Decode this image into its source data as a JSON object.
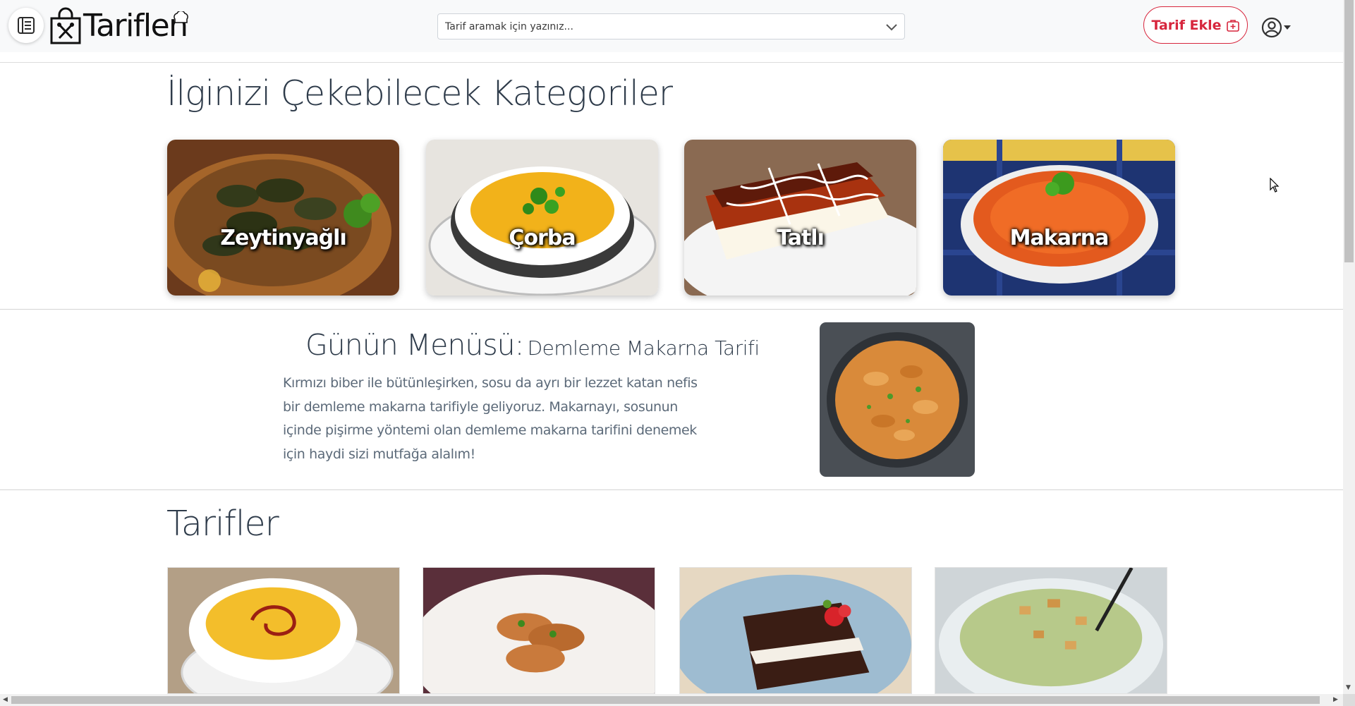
{
  "header": {
    "logo_text": "Tariflen",
    "search_placeholder": "Tarif aramak için yazınız...",
    "add_recipe_label": "Tarif Ekle"
  },
  "categories": {
    "title": "İlginizi Çekebilecek Kategoriler",
    "items": [
      {
        "label": "Zeytinyağlı"
      },
      {
        "label": "Çorba"
      },
      {
        "label": "Tatlı"
      },
      {
        "label": "Makarna"
      }
    ]
  },
  "day_menu": {
    "lead": "Günün Menüsü:",
    "recipe_name": "Demleme Makarna Tarifi",
    "description": "Kırmızı biber ile bütünleşirken, sosu da ayrı bir lezzet katan nefis bir demleme makarna tarifiyle geliyoruz. Makarnayı, sosunun içinde pişirme yöntemi olan demleme makarna tarifini denemek için haydi sizi mutfağa alalım!"
  },
  "recipes": {
    "title": "Tarifler"
  },
  "colors": {
    "accent": "#d7263d",
    "heading": "#2e3b4a",
    "body_text": "#5c6a79",
    "header_bg": "#f8f9fa"
  },
  "icons": {
    "menu": "list-icon",
    "add_recipe": "first-aid-bag-icon",
    "user": "user-circle-icon",
    "search_dropdown": "chevron-down-icon"
  }
}
